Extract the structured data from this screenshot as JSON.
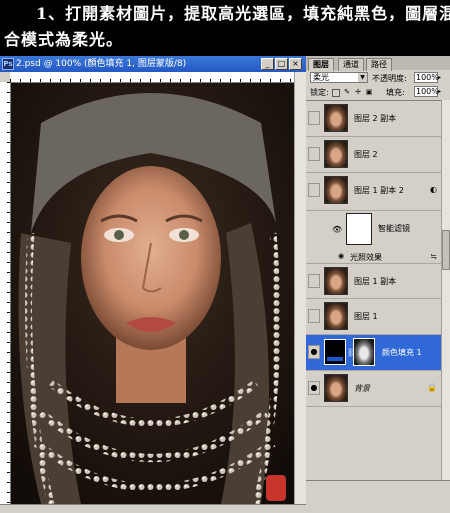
{
  "banner": {
    "line1": "1、打開素材圖片，提取高光選區，填充純黑色，圖層混",
    "line2": "合模式為柔光。"
  },
  "document": {
    "title": "2.psd @ 100% (顏色填充 1, 图层蒙版/8)",
    "app_icon_label": "Ps",
    "minimize": "_",
    "maximize": "□",
    "close": "×"
  },
  "layers_panel": {
    "tabs": [
      "图层",
      "通道",
      "路径"
    ],
    "blend_mode": "柔光",
    "opacity_label": "不透明度:",
    "opacity_value": "100%",
    "lock_label": "锁定:",
    "fill_label": "填充:",
    "fill_value": "100%",
    "layers": [
      {
        "name": "图层 2 副本",
        "visible": false
      },
      {
        "name": "图层 2",
        "visible": false
      },
      {
        "name": "图层 1 副本 2",
        "visible": false,
        "smart_object": true
      },
      {
        "name": "智能滤镜",
        "visible": true
      },
      {
        "name": "光照效果",
        "visible": true
      },
      {
        "name": "图层 1 副本",
        "visible": false
      },
      {
        "name": "图层 1",
        "visible": false
      },
      {
        "name": "颜色填充 1",
        "visible": true,
        "selected": true
      },
      {
        "name": "背景",
        "visible": true,
        "locked": true
      }
    ]
  },
  "colors": {
    "title_bar": "#2458c4",
    "selection": "#3168d8",
    "panel_bg": "#d4d0c8",
    "seal": "#c8352d"
  }
}
